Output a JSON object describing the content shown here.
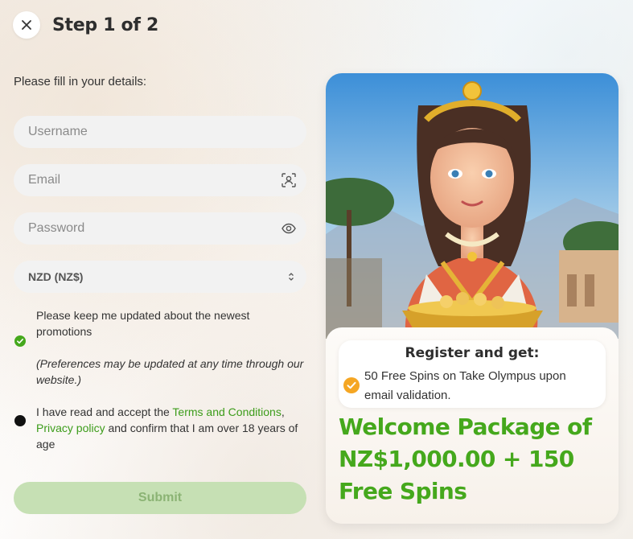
{
  "header": {
    "close_icon": "close-icon",
    "title": "Step 1 of 2"
  },
  "form": {
    "intro": "Please fill in your details:",
    "username": {
      "placeholder": "Username"
    },
    "email": {
      "placeholder": "Email",
      "icon": "autofill-contact-icon"
    },
    "password": {
      "placeholder": "Password",
      "icon": "eye-icon"
    },
    "currency": {
      "value": "NZD (NZ$)",
      "icon": "updown-chevron-icon"
    },
    "promotions": {
      "text": "Please keep me updated about the newest promotions",
      "note": "(Preferences may be updated at any time through our website.)",
      "checked": true
    },
    "terms": {
      "prefix": "I have read and accept the ",
      "terms_link": "Terms and Conditions",
      "comma": ",",
      "privacy_link": "Privacy policy",
      "suffix": " and confirm that I am over 18 years of age",
      "checked": false
    },
    "submit_label": "Submit"
  },
  "promo": {
    "register_title": "Register and get:",
    "register_item": "50 Free Spins on Take Olympus upon email validation.",
    "welcome": "Welcome Package of NZ$1,000.00 + 150 Free Spins"
  },
  "colors": {
    "accent_green": "#45a81c",
    "link_green": "#3c9c1a",
    "check_orange": "#f5a623",
    "submit_disabled": "#c6e0b4"
  }
}
